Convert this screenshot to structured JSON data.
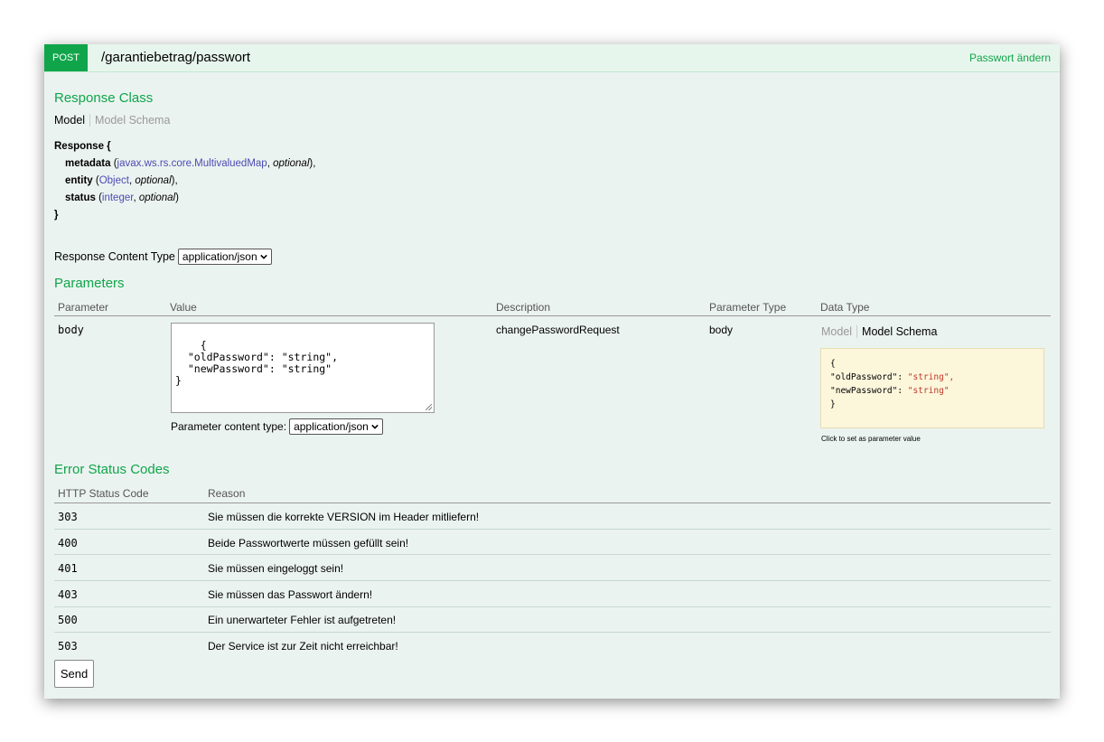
{
  "operation": {
    "method": "POST",
    "path": "/garantiebetrag/passwort",
    "summary": "Passwort ändern"
  },
  "response_class": {
    "title": "Response Class",
    "tabs": [
      "Model",
      "Model Schema"
    ],
    "model": {
      "name": "Response {",
      "close": "}",
      "properties": [
        {
          "name": "metadata",
          "type": "javax.ws.rs.core.MultivaluedMap",
          "optional": "optional",
          "suffix": "),"
        },
        {
          "name": "entity",
          "type": "Object",
          "optional": "optional",
          "suffix": "),"
        },
        {
          "name": "status",
          "type": "integer",
          "optional": "optional",
          "suffix": ")"
        }
      ]
    }
  },
  "response_content_type": {
    "label": "Response Content Type",
    "value": "application/json"
  },
  "parameters": {
    "title": "Parameters",
    "headers": [
      "Parameter",
      "Value",
      "Description",
      "Parameter Type",
      "Data Type"
    ],
    "row": {
      "parameter": "body",
      "value": "{\n  \"oldPassword\": \"string\",\n  \"newPassword\": \"string\"\n}",
      "description": "changePasswordRequest",
      "parameter_type": "body",
      "data_type_tabs": [
        "Model",
        "Model Schema"
      ],
      "schema_lines": [
        {
          "k": "{",
          "v": ""
        },
        {
          "k": "\"oldPassword\": ",
          "v": "\"string\","
        },
        {
          "k": "\"newPassword\": ",
          "v": "\"string\""
        },
        {
          "k": "}",
          "v": ""
        }
      ],
      "click_hint": "Click to set as parameter value",
      "content_type_label": "Parameter content type:",
      "content_type_value": "application/json"
    }
  },
  "error_status_codes": {
    "title": "Error Status Codes",
    "headers": [
      "HTTP Status Code",
      "Reason"
    ],
    "rows": [
      {
        "code": "303",
        "reason": "Sie müssen die korrekte VERSION im Header mitliefern!"
      },
      {
        "code": "400",
        "reason": "Beide Passwortwerte müssen gefüllt sein!"
      },
      {
        "code": "401",
        "reason": "Sie müssen eingeloggt sein!"
      },
      {
        "code": "403",
        "reason": "Sie müssen das Passwort ändern!"
      },
      {
        "code": "500",
        "reason": "Ein unerwarteter Fehler ist aufgetreten!"
      },
      {
        "code": "503",
        "reason": "Der Service ist zur Zeit nicht erreichbar!"
      }
    ]
  },
  "send_label": "Send",
  "icons": {
    "select": "chevron-down-icon",
    "resize": "resize-handle-icon"
  },
  "colors": {
    "accent": "#10a54a",
    "panel": "#ebf3f0",
    "header": "#e7f6ec",
    "schema_bg": "#fcf6db",
    "type_link": "#4b4bb3",
    "string": "#c0392b"
  }
}
